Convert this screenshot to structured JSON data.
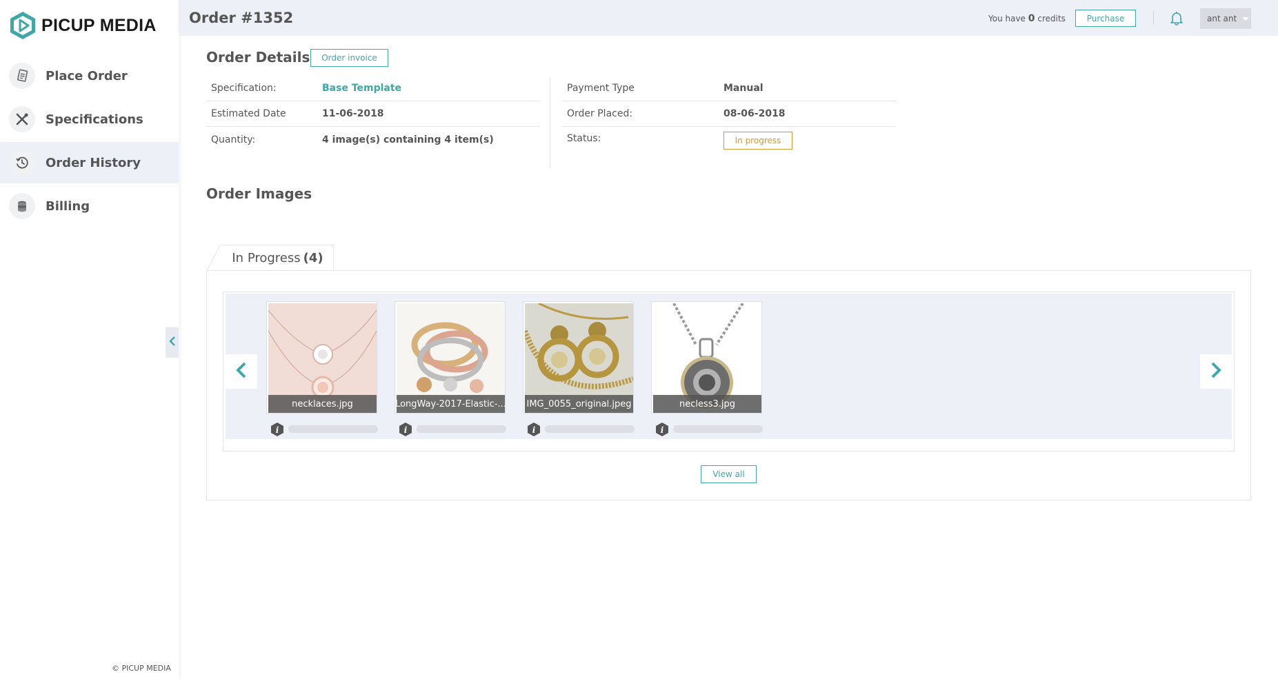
{
  "brand": {
    "name": "PICUP MEDIA",
    "accent": "#3fa7a7",
    "copyright": "© PICUP MEDIA"
  },
  "sidebar": {
    "items": [
      {
        "label": "Place Order",
        "icon": "receipt-icon",
        "active": false
      },
      {
        "label": "Specifications",
        "icon": "tools-icon",
        "active": false
      },
      {
        "label": "Order History",
        "icon": "history-icon",
        "active": true
      },
      {
        "label": "Billing",
        "icon": "coins-icon",
        "active": false
      }
    ]
  },
  "header": {
    "title": "Order #1352",
    "credits_prefix": "You have",
    "credits_value": "0",
    "credits_suffix": "credits",
    "purchase_label": "Purchase",
    "user_name": "ant ant"
  },
  "order_details": {
    "title": "Order Details",
    "invoice_label": "Order invoice",
    "left": [
      {
        "label": "Specification:",
        "value": "Base Template"
      },
      {
        "label": "Estimated Date",
        "value": "11-06-2018"
      },
      {
        "label": "Quantity:",
        "value": "4 image(s) containing 4 item(s)"
      }
    ],
    "right": [
      {
        "label": "Payment Type",
        "value": "Manual"
      },
      {
        "label": "Order Placed:",
        "value": "08-06-2018"
      },
      {
        "label": "Status:",
        "value": "In progress"
      }
    ],
    "status_color": "#d29a2c"
  },
  "order_images": {
    "title": "Order Images",
    "tab_label": "In Progress",
    "tab_count": "(4)",
    "view_all_label": "View all",
    "images": [
      {
        "filename": "necklaces.jpg"
      },
      {
        "filename": "LongWay-2017-Elastic-..."
      },
      {
        "filename": "IMG_0055_original.jpeg"
      },
      {
        "filename": "necless3.jpg"
      }
    ]
  }
}
